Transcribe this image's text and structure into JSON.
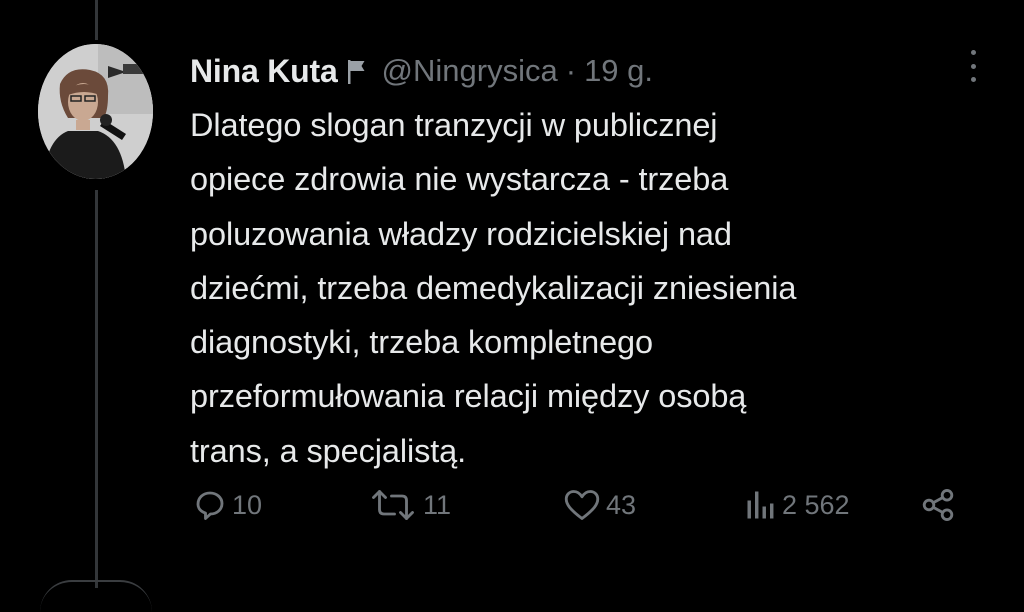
{
  "tweet": {
    "author_name": "Nina Kuta",
    "handle": "@Ningrysica",
    "separator": "·",
    "time": "19 g.",
    "text": "Dlatego slogan tranzycji w publicznej\nopiece zdrowia  nie wystarcza - trzeba\npoluzowania władzy rodzicielskiej nad\ndziećmi, trzeba demedykalizacji zniesienia\ndiagnostyki, trzeba kompletnego\nprzeformułowania relacji między osobą\ntrans, a specjalistą.",
    "avatar_icon": "profile-photo",
    "flag_icon": "flag-icon",
    "more_icon": "more-dots-icon"
  },
  "actions": {
    "replies": "10",
    "retweets": "11",
    "likes": "43",
    "views": "2 562",
    "reply_icon": "reply-icon",
    "retweet_icon": "retweet-icon",
    "like_icon": "heart-icon",
    "views_icon": "views-icon",
    "share_icon": "share-icon"
  },
  "colors": {
    "background": "#000000",
    "text_primary": "#e7e9ea",
    "text_secondary": "#71767b",
    "thread_line": "#333639"
  }
}
